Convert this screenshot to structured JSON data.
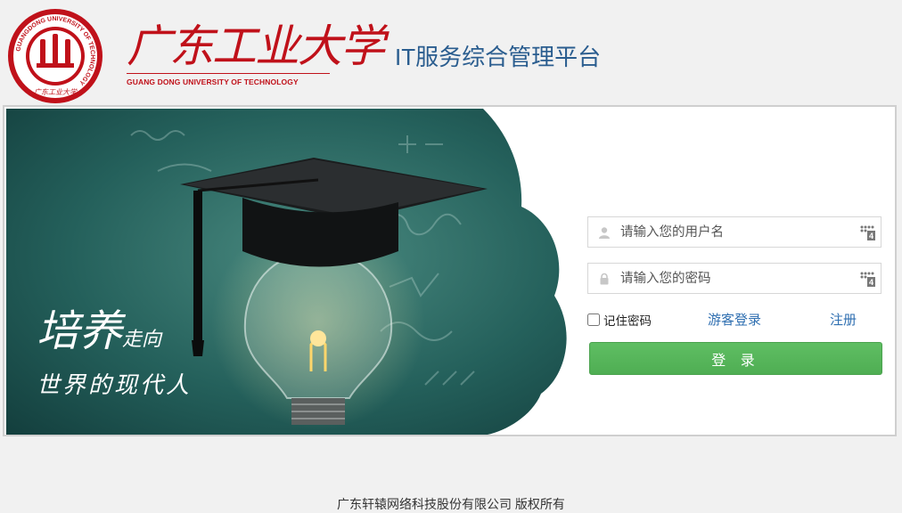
{
  "header": {
    "seal_ring_text": "GUANGDONG UNIVERSITY OF TECHNOLOGY",
    "seal_center_text": "广东工业大学",
    "brand_cn": "广东工业大学",
    "brand_en": "GUANG DONG UNIVERSITY OF TECHNOLOGY",
    "platform_title": "IT服务综合管理平台"
  },
  "hero": {
    "slogan_big": "培养",
    "slogan_small": "走向",
    "slogan_line2": "世界的现代人",
    "colors": {
      "board": "#1d4f4d",
      "board_light": "#3f7b72"
    }
  },
  "login": {
    "username_placeholder": "请输入您的用户名",
    "password_placeholder": "请输入您的密码",
    "username_icon": "user-icon",
    "password_icon": "lock-icon",
    "keyboard_icon": "virtual-keyboard-icon",
    "remember_label": "记住密码",
    "guest_label": "游客登录",
    "register_label": "注册",
    "login_button": "登 录",
    "colors": {
      "link": "#2f6fb1",
      "button": "#55b659"
    }
  },
  "footer": {
    "copyright": "广东轩辕网络科技股份有限公司 版权所有"
  },
  "colors": {
    "brand_red": "#c0111a",
    "title_blue": "#2a5d8f"
  }
}
